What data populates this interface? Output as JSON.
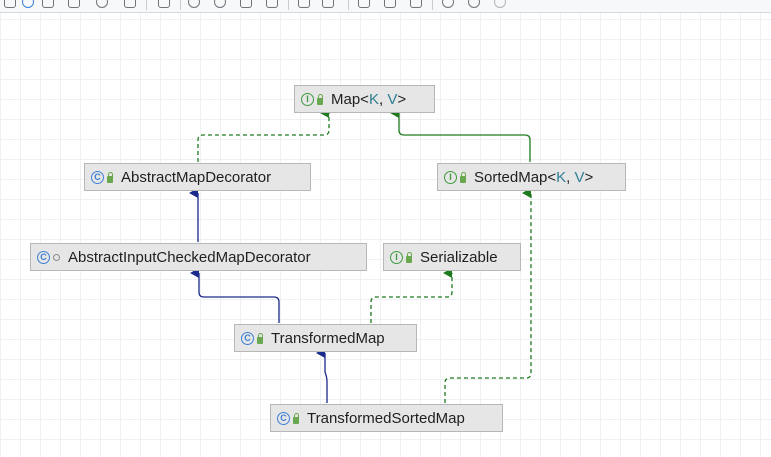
{
  "diagram": {
    "nodes": {
      "map": {
        "kind": "interface",
        "name": "Map<",
        "params": [
          "K",
          "V"
        ],
        "close": ">"
      },
      "abstract_map_decorator": {
        "kind": "class",
        "name": "AbstractMapDecorator"
      },
      "sorted_map": {
        "kind": "interface",
        "name": "SortedMap<",
        "params": [
          "K",
          "V"
        ],
        "close": ">"
      },
      "abstract_input_checked_map_decorator": {
        "kind": "class",
        "name": "AbstractInputCheckedMapDecorator"
      },
      "serializable": {
        "kind": "interface",
        "name": "Serializable"
      },
      "transformed_map": {
        "kind": "class",
        "name": "TransformedMap"
      },
      "transformed_sorted_map": {
        "kind": "class",
        "name": "TransformedSortedMap"
      }
    },
    "edges": [
      {
        "from": "abstract_map_decorator",
        "to": "map",
        "type": "implements"
      },
      {
        "from": "sorted_map",
        "to": "map",
        "type": "extends"
      },
      {
        "from": "abstract_input_checked_map_decorator",
        "to": "abstract_map_decorator",
        "type": "extends"
      },
      {
        "from": "transformed_map",
        "to": "abstract_input_checked_map_decorator",
        "type": "extends"
      },
      {
        "from": "transformed_map",
        "to": "serializable",
        "type": "implements"
      },
      {
        "from": "transformed_sorted_map",
        "to": "transformed_map",
        "type": "extends"
      },
      {
        "from": "transformed_sorted_map",
        "to": "sorted_map",
        "type": "implements"
      }
    ]
  },
  "icons": {
    "interface_badge": "interface-icon",
    "class_badge": "class-icon",
    "public_modifier": "lock-icon",
    "package_modifier": "dot-icon"
  },
  "colors": {
    "interface_green": "#3f9b3f",
    "class_blue": "#3d7fd6",
    "extends_edge": "#1a2a8c",
    "implements_edge": "#1e7a1e",
    "node_fill": "#e6e6e6",
    "type_param": "#2f7f93"
  }
}
